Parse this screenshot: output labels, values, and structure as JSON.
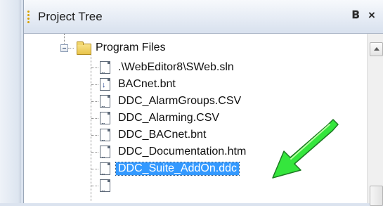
{
  "panel": {
    "title": "Project Tree",
    "pin_glyph": "ᵖ",
    "close_glyph": "×"
  },
  "tree": {
    "folder_label": "Program Files",
    "items": [
      {
        "label": ".\\WebEditor8\\SWeb.sln",
        "icon": "document-icon",
        "selected": false
      },
      {
        "label": "BACnet.bnt",
        "icon": "bnt-document-icon",
        "selected": false
      },
      {
        "label": "DDC_AlarmGroups.CSV",
        "icon": "document-icon",
        "selected": false
      },
      {
        "label": "DDC_Alarming.CSV",
        "icon": "document-icon",
        "selected": false
      },
      {
        "label": "DDC_BACnet.bnt",
        "icon": "document-icon",
        "selected": false
      },
      {
        "label": "DDC_Documentation.htm",
        "icon": "document-icon",
        "selected": false
      },
      {
        "label": "DDC_Suite_AddOn.ddc",
        "icon": "document-icon",
        "selected": true
      }
    ]
  },
  "colors": {
    "selection": "#3399ff",
    "arrow": "#35e63d",
    "arrow_outline": "#1c7a22",
    "titlebar": "#e6ecf5",
    "grip": "#d9a300"
  },
  "annotation": {
    "icon": "green-arrow-icon"
  }
}
